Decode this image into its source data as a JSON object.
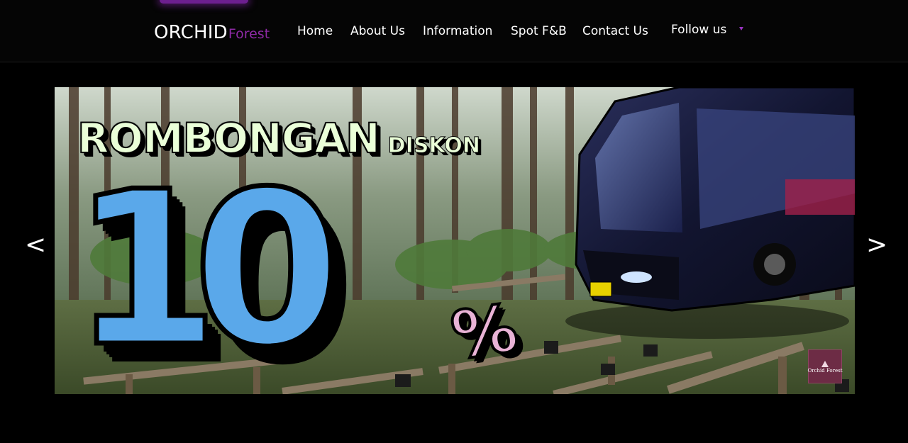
{
  "brand": {
    "main": "ORCHID",
    "accent": "Forest"
  },
  "nav": {
    "home": "Home",
    "about": "About Us",
    "information": "Information",
    "spot_fb": "Spot F&B",
    "contact": "Contact Us",
    "follow": "Follow us"
  },
  "carousel": {
    "prev": "<",
    "next": ">",
    "slide": {
      "headline": "ROMBONGAN",
      "subheadline": "DISKON",
      "number": "10",
      "percent": "%",
      "badge": "Orchid Forest"
    }
  },
  "colors": {
    "accent": "#8f2aa6",
    "background": "#000000",
    "number_fill": "#5aa8ea"
  }
}
